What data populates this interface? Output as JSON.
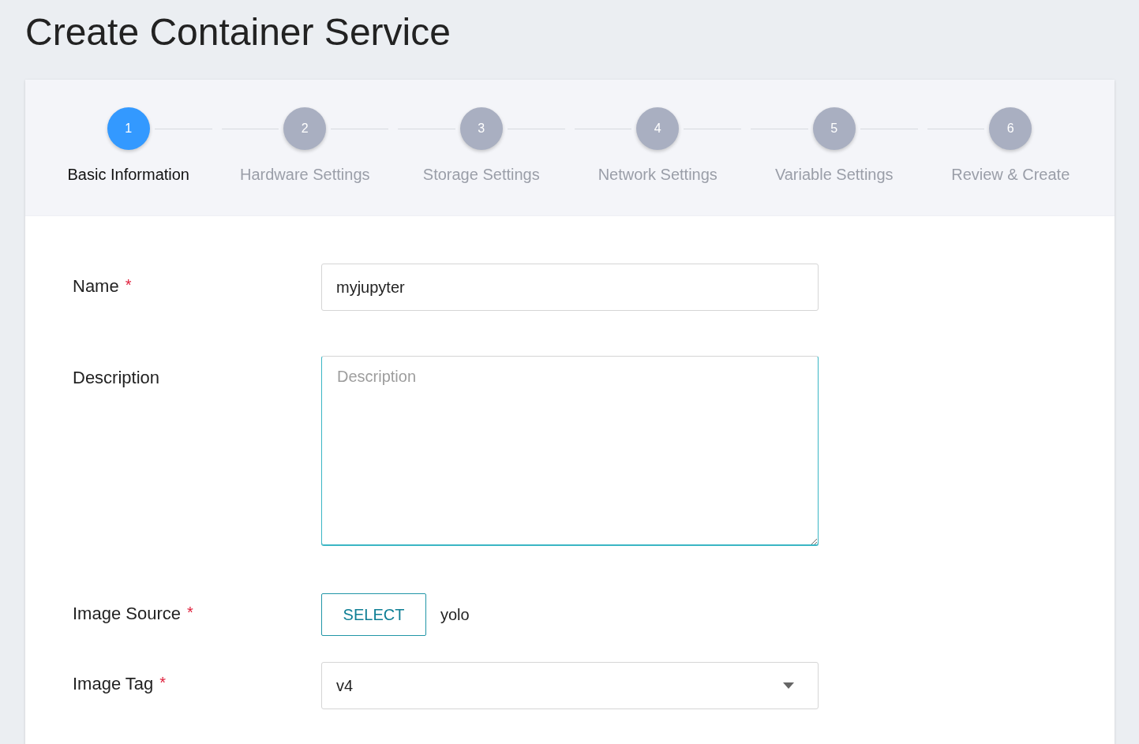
{
  "title": "Create Container Service",
  "steps": [
    {
      "number": "1",
      "label": "Basic Information",
      "selected": true
    },
    {
      "number": "2",
      "label": "Hardware Settings",
      "selected": false
    },
    {
      "number": "3",
      "label": "Storage Settings",
      "selected": false
    },
    {
      "number": "4",
      "label": "Network Settings",
      "selected": false
    },
    {
      "number": "5",
      "label": "Variable Settings",
      "selected": false
    },
    {
      "number": "6",
      "label": "Review & Create",
      "selected": false
    }
  ],
  "fields": [
    {
      "kind": "text",
      "label": "Name",
      "required_mark": "*",
      "value": "myjupyter"
    },
    {
      "kind": "textarea",
      "label": "Description",
      "placeholder": "Description"
    },
    {
      "kind": "picker",
      "label": "Image Source",
      "required_mark": "*",
      "button": "SELECT",
      "value": "yolo"
    },
    {
      "kind": "select",
      "label": "Image Tag",
      "required_mark": "*",
      "value": "v4"
    }
  ]
}
